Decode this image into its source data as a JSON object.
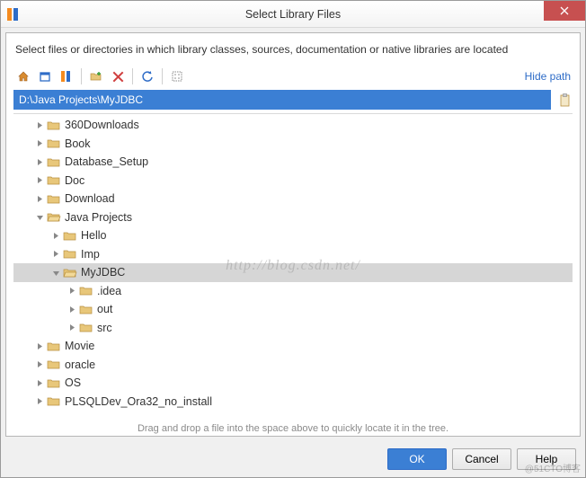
{
  "title": "Select Library Files",
  "instruction": "Select files or directories in which library classes, sources, documentation or native libraries are located",
  "hide_path": "Hide path",
  "path": "D:\\Java Projects\\MyJDBC",
  "hint": "Drag and drop a file into the space above to quickly locate it in the tree.",
  "watermark": "http://blog.csdn.net/",
  "attrib": "@51CTO博客",
  "buttons": {
    "ok": "OK",
    "cancel": "Cancel",
    "help": "Help"
  },
  "tree": [
    {
      "depth": 1,
      "expanded": false,
      "label": "360Downloads",
      "sel": false
    },
    {
      "depth": 1,
      "expanded": false,
      "label": "Book",
      "sel": false
    },
    {
      "depth": 1,
      "expanded": false,
      "label": "Database_Setup",
      "sel": false
    },
    {
      "depth": 1,
      "expanded": false,
      "label": "Doc",
      "sel": false
    },
    {
      "depth": 1,
      "expanded": false,
      "label": "Download",
      "sel": false
    },
    {
      "depth": 1,
      "expanded": true,
      "label": "Java Projects",
      "sel": false
    },
    {
      "depth": 2,
      "expanded": false,
      "label": "Hello",
      "sel": false
    },
    {
      "depth": 2,
      "expanded": false,
      "label": "Imp",
      "sel": false
    },
    {
      "depth": 2,
      "expanded": true,
      "label": "MyJDBC",
      "sel": true
    },
    {
      "depth": 3,
      "expanded": false,
      "label": ".idea",
      "sel": false
    },
    {
      "depth": 3,
      "expanded": false,
      "label": "out",
      "sel": false
    },
    {
      "depth": 3,
      "expanded": false,
      "label": "src",
      "sel": false
    },
    {
      "depth": 1,
      "expanded": false,
      "label": "Movie",
      "sel": false
    },
    {
      "depth": 1,
      "expanded": false,
      "label": "oracle",
      "sel": false
    },
    {
      "depth": 1,
      "expanded": false,
      "label": "OS",
      "sel": false
    },
    {
      "depth": 1,
      "expanded": false,
      "label": "PLSQLDev_Ora32_no_install",
      "sel": false
    }
  ]
}
